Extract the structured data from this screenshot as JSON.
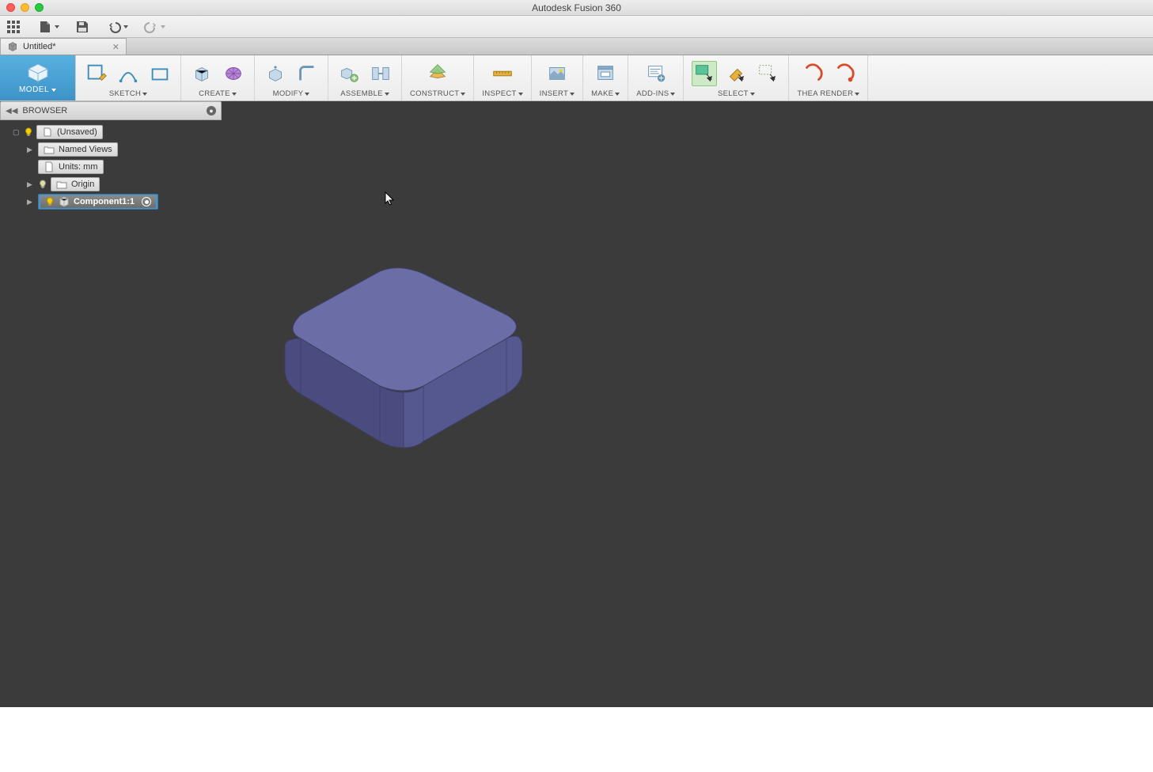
{
  "app": {
    "title": "Autodesk Fusion 360"
  },
  "doc": {
    "tab_title": "Untitled*"
  },
  "workspace": {
    "label": "MODEL"
  },
  "ribbon": {
    "groups": [
      {
        "key": "sketch",
        "label": "SKETCH"
      },
      {
        "key": "create",
        "label": "CREATE"
      },
      {
        "key": "modify",
        "label": "MODIFY"
      },
      {
        "key": "assemble",
        "label": "ASSEMBLE"
      },
      {
        "key": "construct",
        "label": "CONSTRUCT"
      },
      {
        "key": "inspect",
        "label": "INSPECT"
      },
      {
        "key": "insert",
        "label": "INSERT"
      },
      {
        "key": "make",
        "label": "MAKE"
      },
      {
        "key": "addins",
        "label": "ADD-INS"
      },
      {
        "key": "select",
        "label": "SELECT"
      },
      {
        "key": "thea",
        "label": "THEA RENDER"
      }
    ]
  },
  "browser": {
    "title": "BROWSER",
    "root": {
      "label": "(Unsaved)"
    },
    "items": [
      {
        "label": "Named Views"
      },
      {
        "label": "Units: mm"
      },
      {
        "label": "Origin"
      },
      {
        "label": "Component1:1"
      }
    ]
  }
}
